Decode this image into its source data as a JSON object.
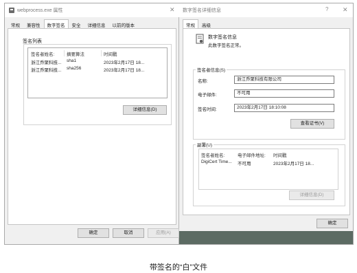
{
  "left_dialog": {
    "title": "webprocess.exe 属性",
    "close_label": "✕",
    "tabs": [
      "常规",
      "兼容性",
      "数字签名",
      "安全",
      "详细信息",
      "以前的版本"
    ],
    "active_tab": "数字签名",
    "group_title": "签名列表",
    "list": {
      "headers": [
        "签名者姓名:",
        "摘要算法",
        "时间戳"
      ],
      "rows": [
        [
          "浙江乔聚科技...",
          "sha1",
          "2023年2月17日 18..."
        ],
        [
          "浙江乔聚科技...",
          "sha256",
          "2023年2月17日 18..."
        ]
      ]
    },
    "details_button": "详细信息(D)",
    "ok_button": "确定",
    "cancel_button": "取消",
    "apply_button": "应用(A)"
  },
  "right_dialog": {
    "title": "数字签名详细信息",
    "help_label": "?",
    "close_label": "✕",
    "tabs": [
      "常规",
      "高级"
    ],
    "active_tab": "常规",
    "info_title": "数字签名信息",
    "info_subtitle": "此数字签名正常。",
    "signer_legend": "签名者信息(S)",
    "name_label": "名称:",
    "name_value": "浙江乔聚科技有限公司",
    "email_label": "电子邮件:",
    "email_value": "不可用",
    "time_label": "签名时间:",
    "time_value": "2023年2月17日 18:10:08",
    "view_cert_button": "查看证书(V)",
    "counter_legend": "副署(U)",
    "counter_list": {
      "headers": [
        "签名者姓名:",
        "电子邮件地址:",
        "时间戳"
      ],
      "rows": [
        [
          "DigiCert Time...",
          "不可用",
          "2023年2月17日 18..."
        ]
      ]
    },
    "details_button": "详细信息(D)",
    "ok_button": "确定"
  },
  "caption": "带签名的“白”文件",
  "colors": {
    "dialog_bg": "#f0f0f0",
    "panel_bg": "#ffffff",
    "bottom_strip": "#5c6b63"
  }
}
